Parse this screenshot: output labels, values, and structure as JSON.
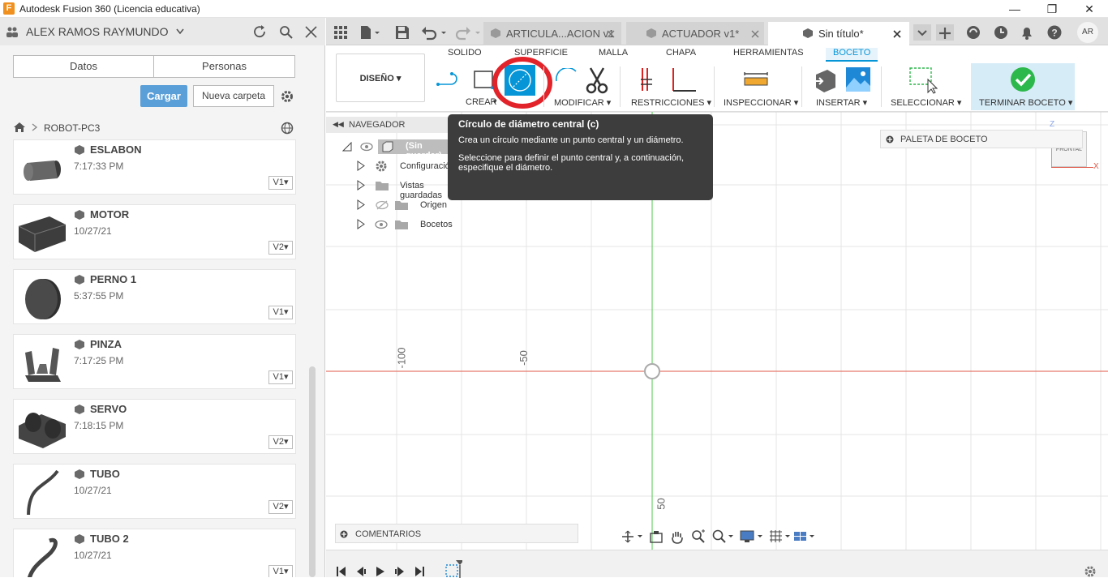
{
  "window": {
    "title": "Autodesk Fusion 360 (Licencia educativa)",
    "logo_letter": "F",
    "minimize": "—",
    "maximize": "❐",
    "close": "✕"
  },
  "data_panel": {
    "user_name": "ALEX RAMOS RAYMUNDO",
    "tabs": [
      "Datos",
      "Personas"
    ],
    "upload_label": "Cargar",
    "new_folder_label": "Nueva carpeta",
    "breadcrumb": "ROBOT-PC3",
    "files": [
      {
        "name": "ESLABON",
        "date": "7:17:33 PM",
        "version": "V1"
      },
      {
        "name": "MOTOR",
        "date": "10/27/21",
        "version": "V2"
      },
      {
        "name": "PERNO 1",
        "date": "5:37:55 PM",
        "version": "V1"
      },
      {
        "name": "PINZA",
        "date": "7:17:25 PM",
        "version": "V1"
      },
      {
        "name": "SERVO",
        "date": "7:18:15 PM",
        "version": "V2"
      },
      {
        "name": "TUBO",
        "date": "10/27/21",
        "version": "V2"
      },
      {
        "name": "TUBO 2",
        "date": "10/27/21",
        "version": "V1"
      }
    ]
  },
  "document_tabs": [
    {
      "label": "ARTICULA...ACION v1",
      "active": false
    },
    {
      "label": "ACTUADOR v1*",
      "active": false
    },
    {
      "label": "Sin título*",
      "active": true
    }
  ],
  "account_initials": "AR",
  "ribbon": {
    "workspace": "DISEÑO",
    "tabs": [
      "SOLIDO",
      "SUPERFICIE",
      "MALLA",
      "CHAPA",
      "HERRAMIENTAS",
      "BOCETO"
    ],
    "active_tab": "BOCETO",
    "groups": [
      "CREAR",
      "MODIFICAR",
      "RESTRICCIONES",
      "INSPECCIONAR",
      "INSERTAR",
      "SELECCIONAR",
      "TERMINAR BOCETO"
    ]
  },
  "tooltip": {
    "title": "Círculo de diámetro central (c)",
    "line1": "Crea un círculo mediante un punto central y un diámetro.",
    "line2": "Seleccione para definir el punto central y, a continuación, especifique el diámetro."
  },
  "browser": {
    "header": "NAVEGADOR",
    "root": "(Sin guardar)",
    "items": [
      "Configuración",
      "Vistas guardadas",
      "Origen",
      "Bocetos"
    ]
  },
  "sketch_palette": "PALETA DE BOCETO",
  "viewcube": {
    "face": "FRONTAL",
    "axis_x": "X",
    "axis_z": "Z"
  },
  "grid_labels": {
    "h1": "-100",
    "h2": "-50",
    "v1": "50"
  },
  "comments_label": "COMENTARIOS",
  "colors": {
    "accent": "#0696d7",
    "x_axis": "#e05a4a",
    "y_axis": "#4cc94c",
    "highlight_ring": "#e2232a",
    "finish_green": "#2db84b"
  }
}
